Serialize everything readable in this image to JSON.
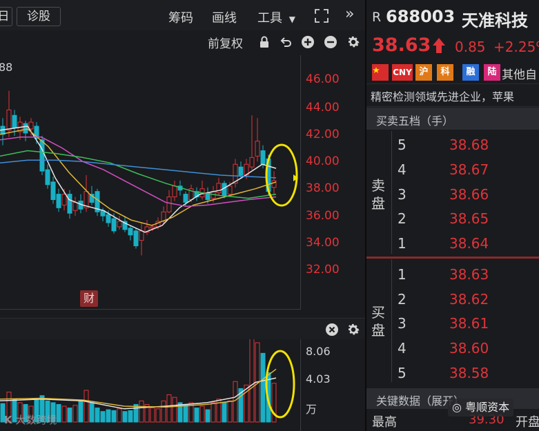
{
  "toolbar": {
    "tab_partial": "日",
    "tab_diagnose": "诊股",
    "chips": "筹码",
    "draw": "画线",
    "tools": "工具",
    "expand": "»",
    "adjust": "前复权"
  },
  "chart": {
    "ma_partial": "88",
    "price_axis": [
      "46.00",
      "44.00",
      "42.00",
      "40.00",
      "38.00",
      "36.00",
      "34.00",
      "32.00"
    ],
    "fin_marker": "财",
    "volume_axis": [
      "8.06",
      "4.03",
      "万"
    ]
  },
  "stock": {
    "prefix": "R",
    "code": "688003",
    "name": "天准科技",
    "price": "38.63",
    "change": "0.85",
    "change_pct": "+2.25%"
  },
  "tags": {
    "cny": "CNY",
    "hu": "沪",
    "ke": "科",
    "rong": "融",
    "lu": "陆",
    "other": "其他自"
  },
  "description": "精密检测领域先进企业，苹果",
  "order_book": {
    "title": "买卖五档（手）",
    "sell_label": "卖盘",
    "buy_label": "买盘",
    "asks": [
      {
        "level": "5",
        "price": "38.68"
      },
      {
        "level": "4",
        "price": "38.67"
      },
      {
        "level": "3",
        "price": "38.66"
      },
      {
        "level": "2",
        "price": "38.65"
      },
      {
        "level": "1",
        "price": "38.64"
      }
    ],
    "bids": [
      {
        "level": "1",
        "price": "38.63"
      },
      {
        "level": "2",
        "price": "38.62"
      },
      {
        "level": "3",
        "price": "38.61"
      },
      {
        "level": "4",
        "price": "38.60"
      },
      {
        "level": "5",
        "price": "38.58"
      }
    ]
  },
  "key_data": {
    "title": "关键数据（展开）",
    "high_label": "最高",
    "high_value": "39.30",
    "open_label": "开盘"
  },
  "watermarks": {
    "left": "大数跨境",
    "right": "粤顺资本"
  },
  "colors": {
    "up": "#e0343a",
    "down": "#19b0c5",
    "highlight": "#f2e200",
    "ma_white": "#e8e8e8",
    "ma_yellow": "#e0b83a",
    "ma_magenta": "#d24fc4",
    "ma_green": "#3bbf5a",
    "ma_blue": "#3f8fd9"
  }
}
